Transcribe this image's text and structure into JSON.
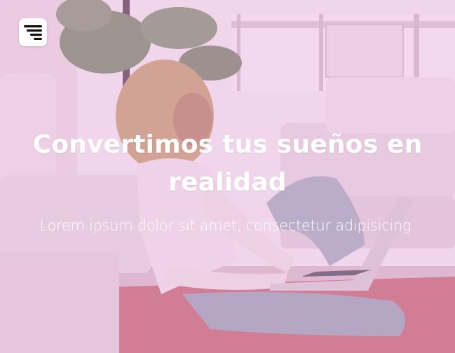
{
  "hero": {
    "title": "Convertimos tus sueños en realidad",
    "subtitle": "Lorem ipsum dolor sit amet, consectetur adipisicing.",
    "overlay_color": "#f0b4e2"
  },
  "menu": {
    "icon": "hamburger-menu-icon"
  }
}
